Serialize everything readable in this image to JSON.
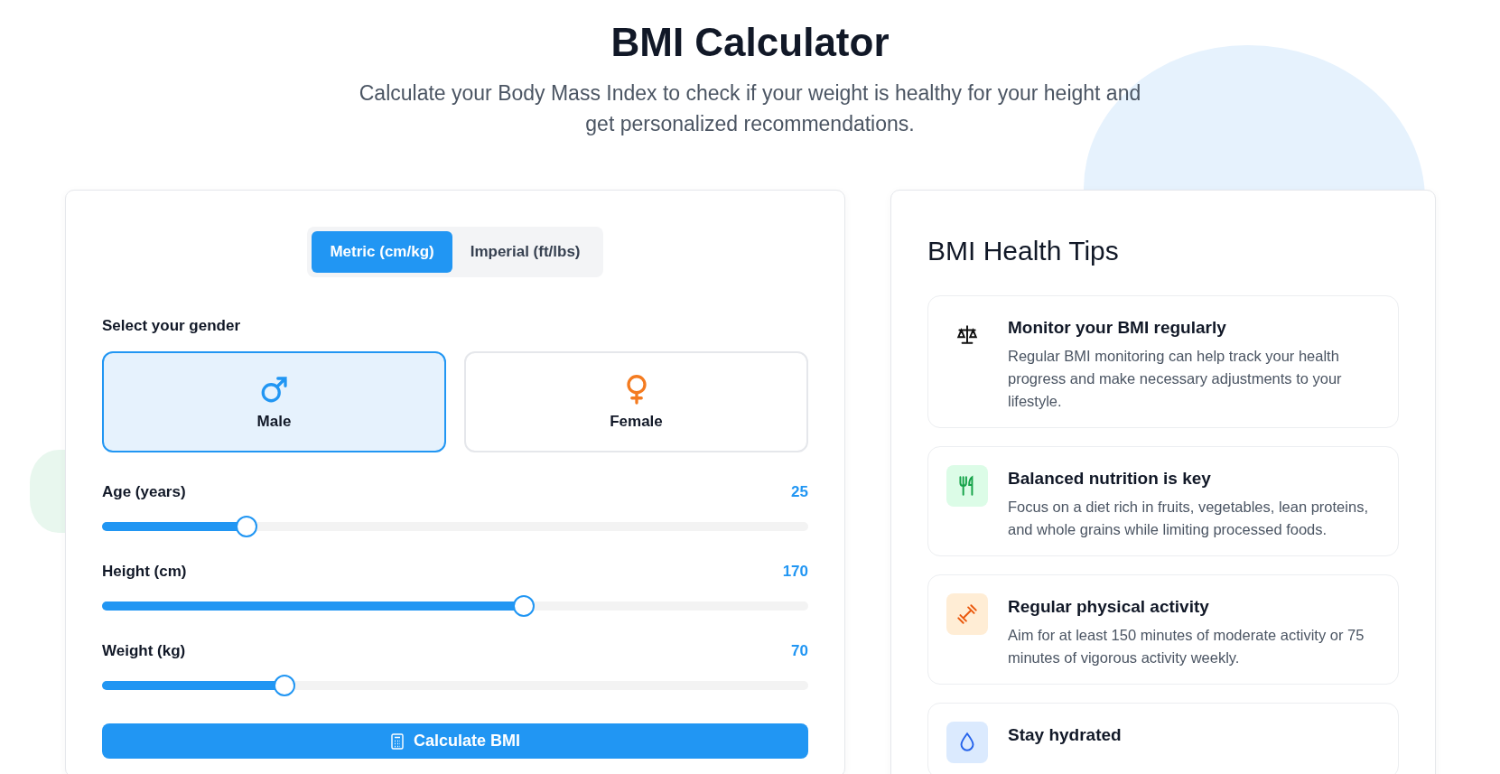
{
  "header": {
    "title": "BMI Calculator",
    "subtitle": "Calculate your Body Mass Index to check if your weight is healthy for your height and get personalized recommendations."
  },
  "calculator": {
    "unit_tabs": [
      {
        "label": "Metric (cm/kg)",
        "selected": true
      },
      {
        "label": "Imperial (ft/lbs)",
        "selected": false
      }
    ],
    "gender_label": "Select your gender",
    "genders": [
      {
        "kind": "male",
        "label": "Male",
        "selected": true
      },
      {
        "kind": "female",
        "label": "Female",
        "selected": false
      }
    ],
    "sliders": [
      {
        "label": "Age (years)",
        "value": "25",
        "level": 0.205
      },
      {
        "label": "Height (cm)",
        "value": "170",
        "level": 0.597
      },
      {
        "label": "Weight (kg)",
        "value": "70",
        "level": 0.258
      }
    ],
    "calculate_button": "Calculate BMI"
  },
  "tips": {
    "title": "BMI Health Tips",
    "items": [
      {
        "kind": "scale",
        "title": "Monitor your BMI regularly",
        "text": "Regular BMI monitoring can help track your health progress and make necessary adjustments to your lifestyle."
      },
      {
        "kind": "nutrition",
        "title": "Balanced nutrition is key",
        "text": "Focus on a diet rich in fruits, vegetables, lean proteins, and whole grains while limiting processed foods."
      },
      {
        "kind": "activity",
        "title": "Regular physical activity",
        "text": "Aim for at least 150 minutes of moderate activity or 75 minutes of vigorous activity weekly."
      },
      {
        "kind": "water",
        "title": "Stay hydrated"
      }
    ]
  }
}
